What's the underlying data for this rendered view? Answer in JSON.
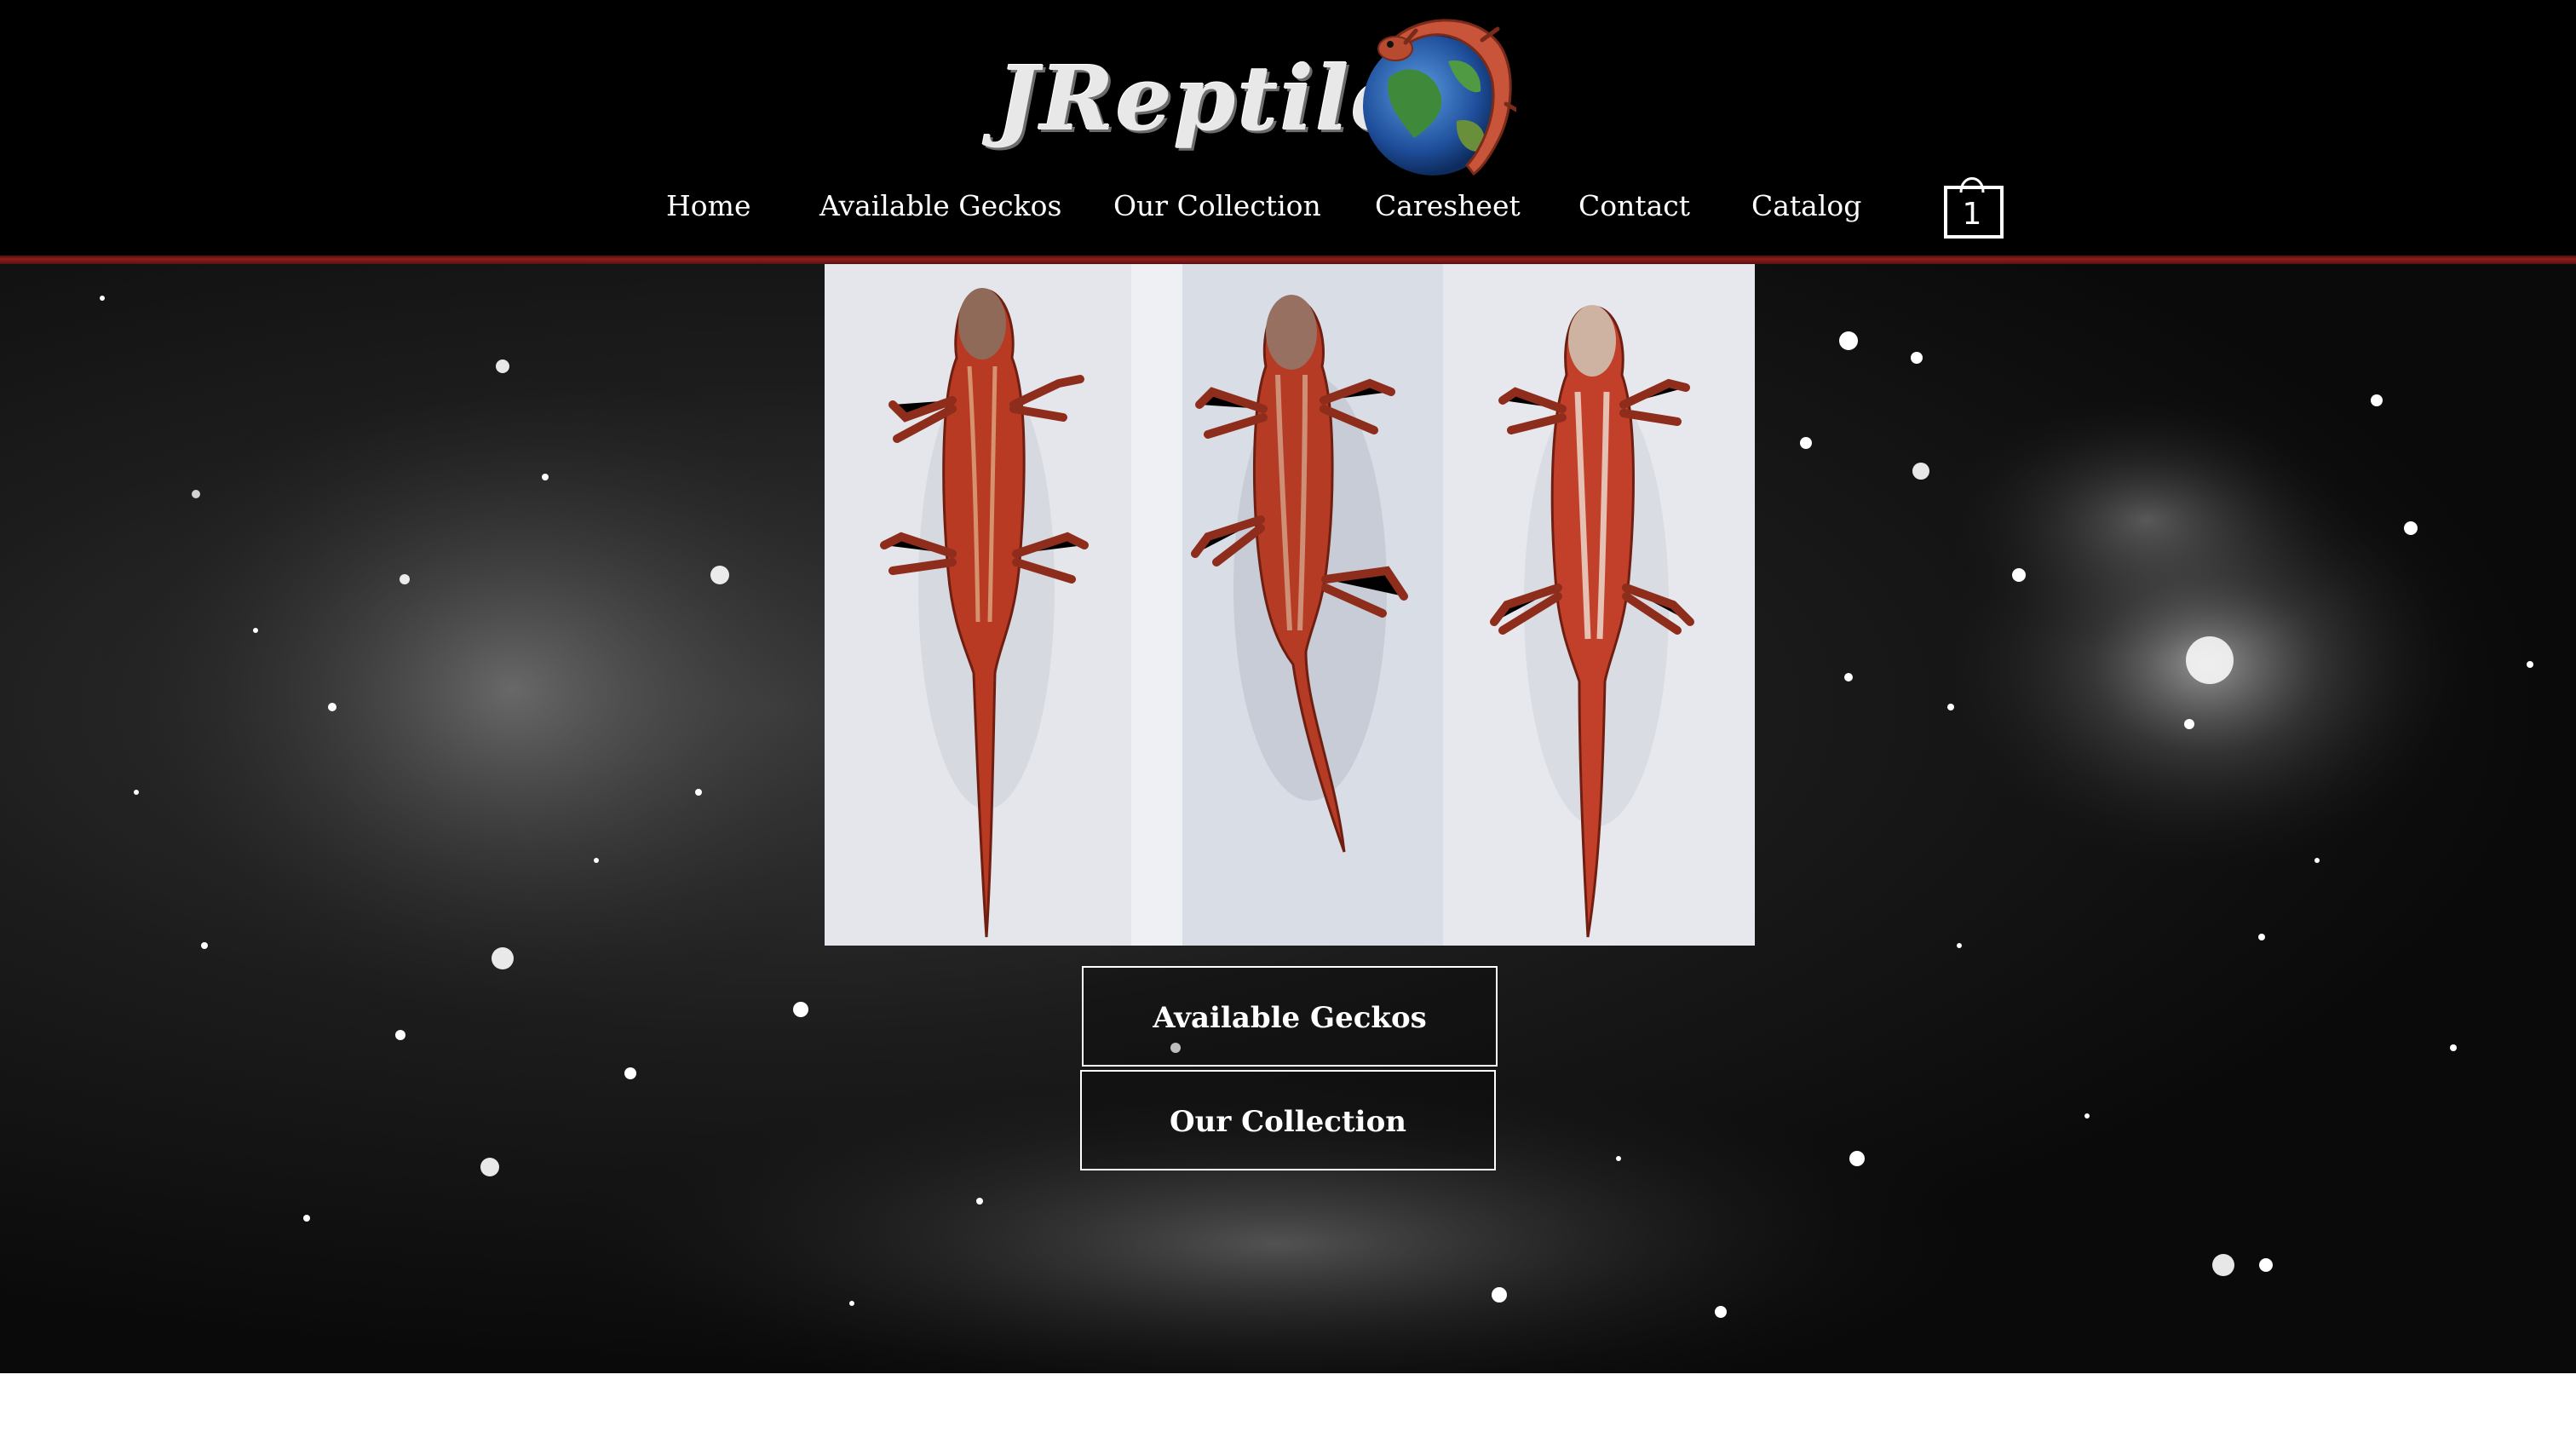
{
  "brand": {
    "logo_text": "JReptiles"
  },
  "nav": {
    "items": [
      {
        "label": "Home"
      },
      {
        "label": "Available Geckos"
      },
      {
        "label": "Our Collection"
      },
      {
        "label": "Caresheet"
      },
      {
        "label": "Contact"
      },
      {
        "label": "Catalog"
      }
    ],
    "cart_count": "1"
  },
  "hero": {
    "buttons": [
      {
        "label": "Available Geckos"
      },
      {
        "label": "Our Collection"
      }
    ]
  },
  "colors": {
    "header_bg": "#000000",
    "accent_rule": "#8e1d1d",
    "gecko_red": "#b83a22",
    "text": "#ffffff"
  },
  "icons": {
    "cart": "shopping-bag-icon",
    "logo": "gecko-globe-icon"
  }
}
